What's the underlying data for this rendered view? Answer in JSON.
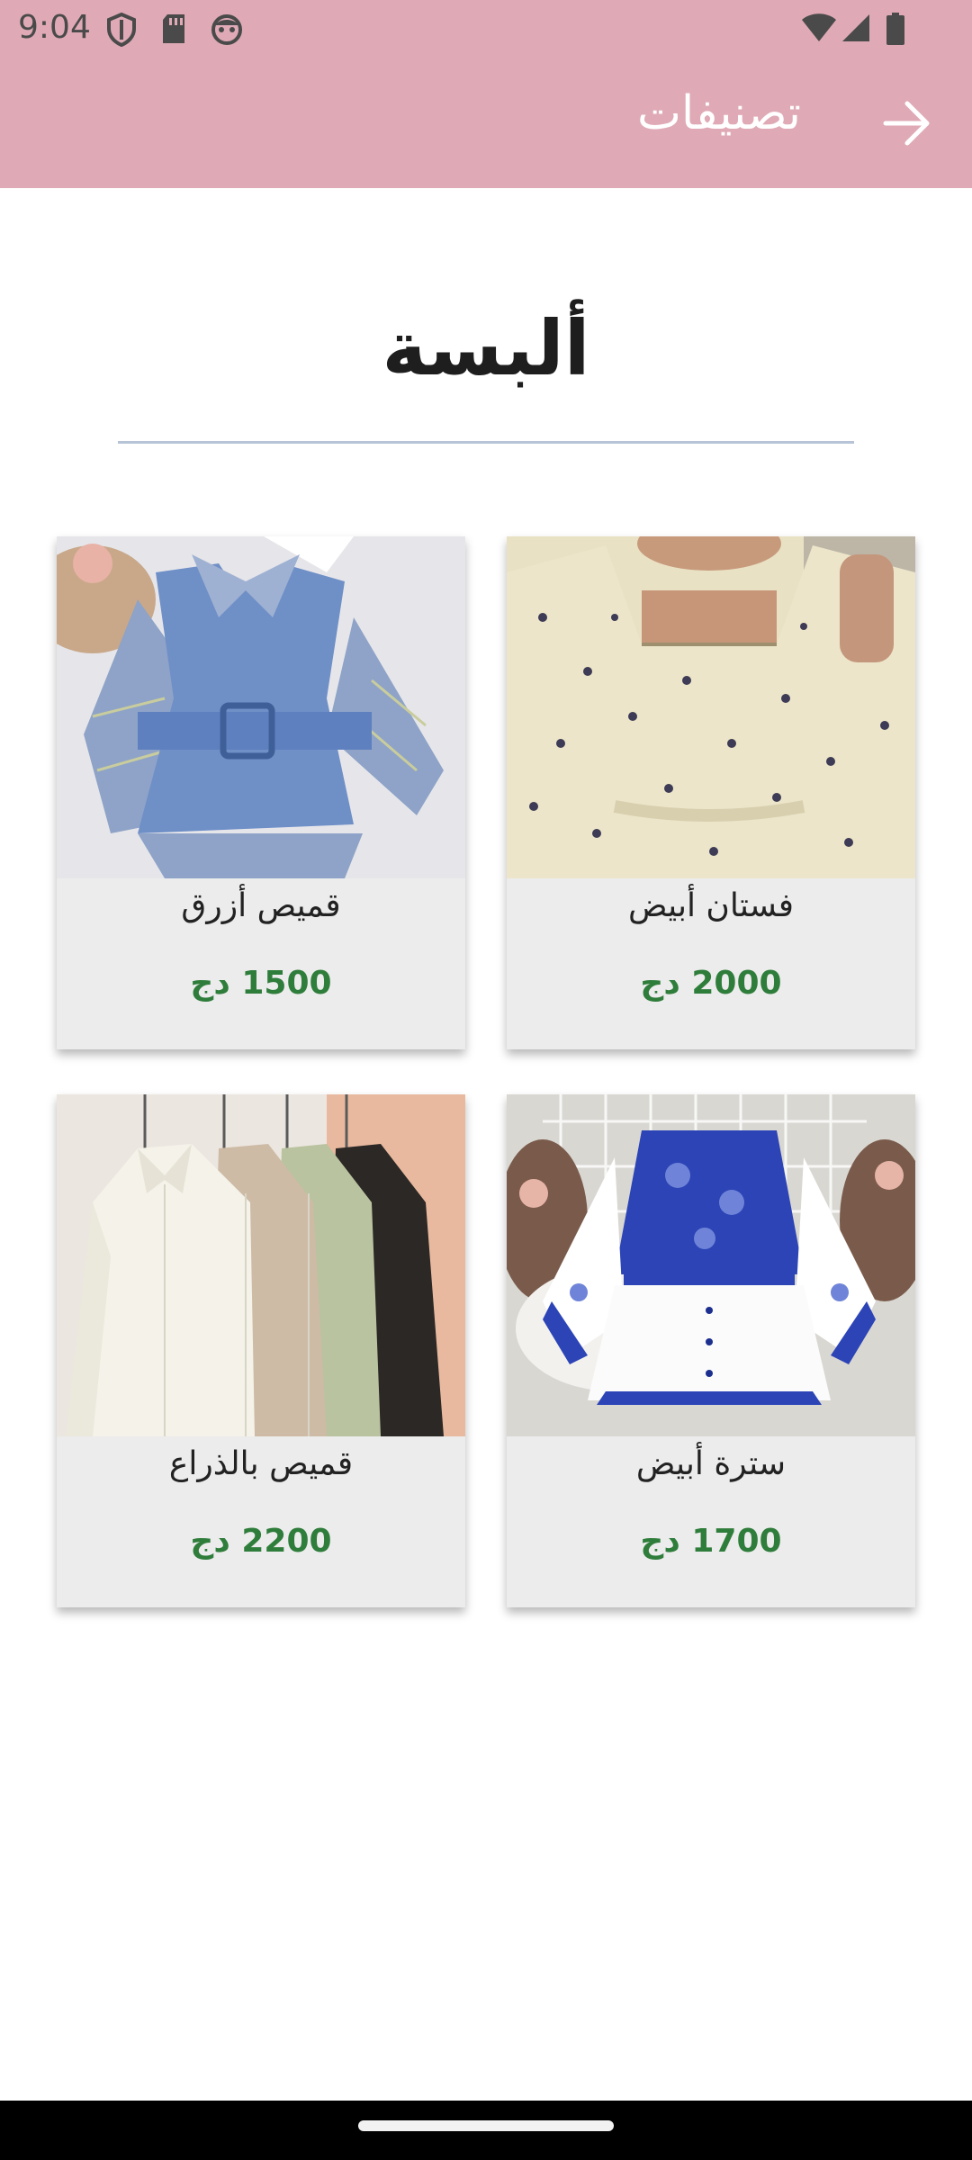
{
  "status_bar": {
    "time": "9:04",
    "left_icons": [
      "shield-icon",
      "sd-card-icon",
      "android-face-icon"
    ],
    "right_icons": [
      "wifi-icon",
      "signal-icon",
      "battery-icon"
    ]
  },
  "toolbar": {
    "title": "تصنيفات",
    "back_icon": "arrow-back-icon",
    "background_color": "#dfaab6"
  },
  "page": {
    "heading": "ألبسة"
  },
  "products": [
    {
      "name": "فستان أبيض",
      "price": "2000 دج",
      "image": "floral-cream-dress"
    },
    {
      "name": "قميص أزرق",
      "price": "1500 دج",
      "image": "blue-vest-plaid-shirt"
    },
    {
      "name": "سترة أبيض",
      "price": "1700 دج",
      "image": "blue-white-porcelain-blouse"
    },
    {
      "name": "قميص بالذراع",
      "price": "2200 دج",
      "image": "satin-shirts-on-hangers"
    }
  ],
  "colors": {
    "price": "#2f7d3b",
    "card_background": "#ececec"
  }
}
